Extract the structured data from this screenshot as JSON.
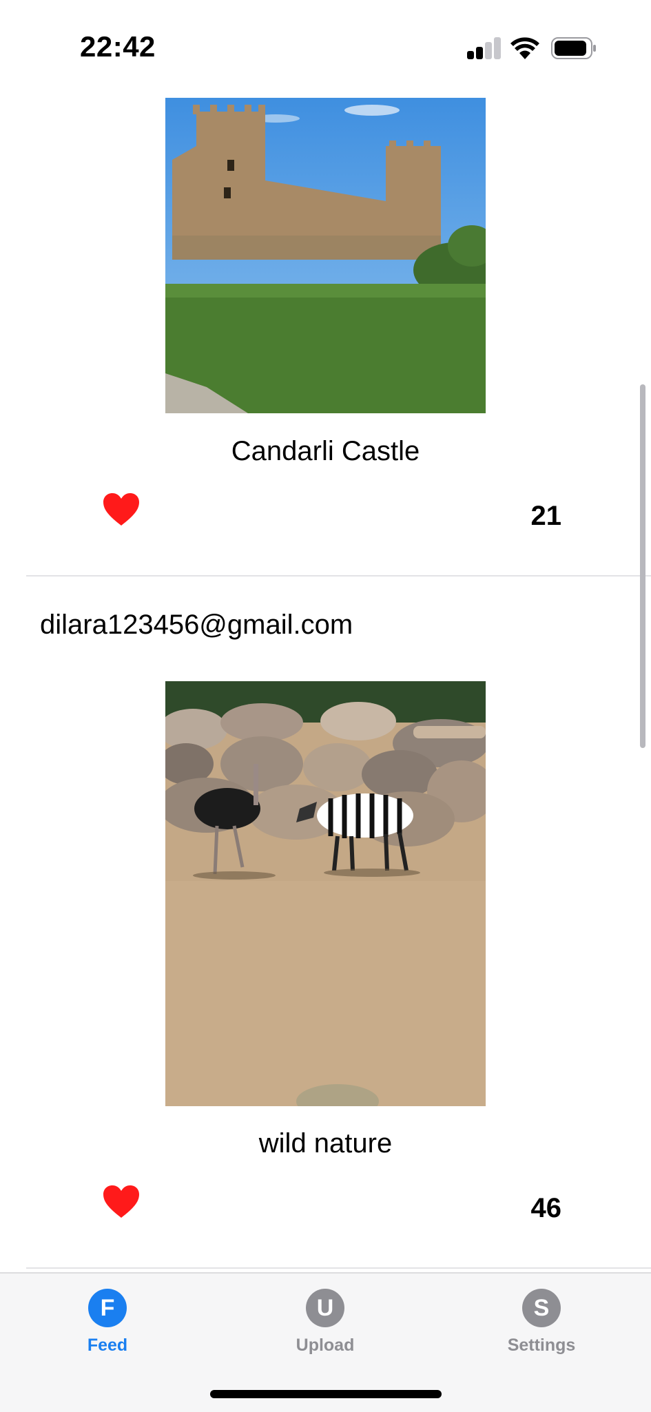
{
  "status_bar": {
    "time": "22:42"
  },
  "feed": {
    "posts": [
      {
        "image_description": "castle-photo",
        "caption": "Candarli Castle",
        "like_icon": "heart-icon",
        "like_count": "21"
      },
      {
        "user": "dilara123456@gmail.com",
        "image_description": "zebra-ostrich-photo",
        "caption": "wild nature",
        "like_icon": "heart-icon",
        "like_count": "46"
      }
    ]
  },
  "tab_bar": {
    "tabs": [
      {
        "icon_letter": "F",
        "label": "Feed",
        "active": true
      },
      {
        "icon_letter": "U",
        "label": "Upload",
        "active": false
      },
      {
        "icon_letter": "S",
        "label": "Settings",
        "active": false
      }
    ]
  },
  "colors": {
    "accent": "#1a7ff0",
    "heart": "#ff1a1a",
    "inactive": "#8e8e93"
  }
}
